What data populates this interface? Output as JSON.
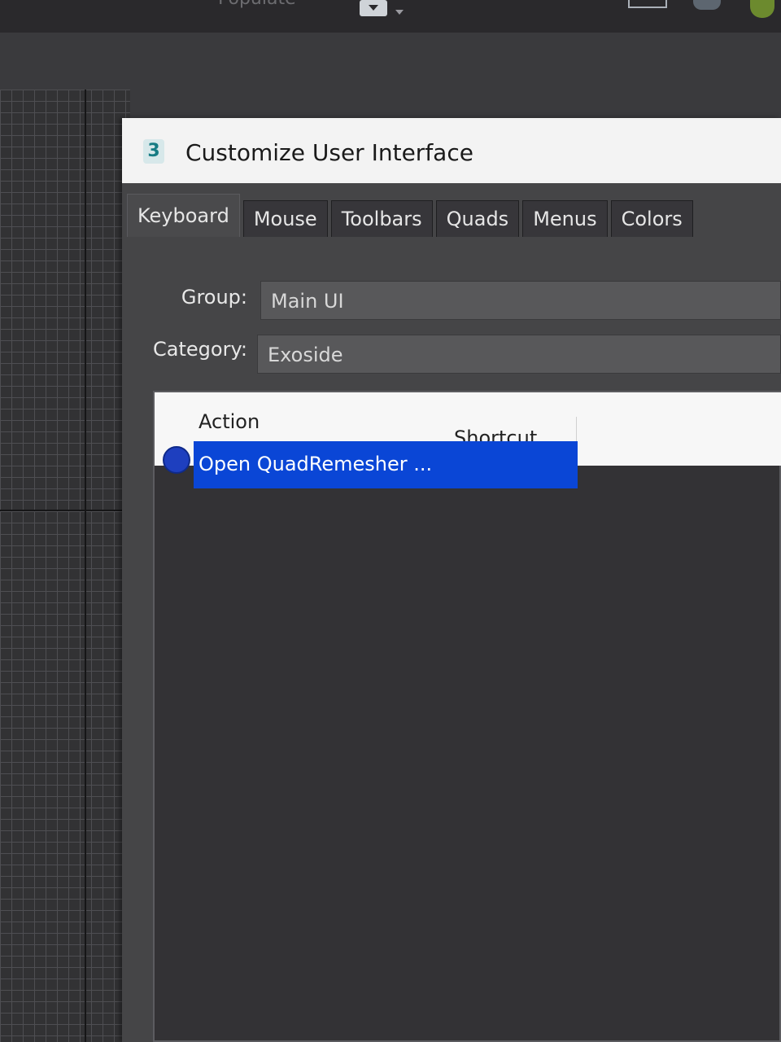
{
  "background": {
    "toolbar_fragment_text": "Populate"
  },
  "dialog": {
    "app_icon_glyph": "3",
    "title": "Customize User Interface",
    "tabs": [
      {
        "label": "Keyboard",
        "active": true
      },
      {
        "label": "Mouse",
        "active": false
      },
      {
        "label": "Toolbars",
        "active": false
      },
      {
        "label": "Quads",
        "active": false
      },
      {
        "label": "Menus",
        "active": false
      },
      {
        "label": "Colors",
        "active": false
      }
    ],
    "group": {
      "label": "Group:",
      "value": "Main UI"
    },
    "category": {
      "label": "Category:",
      "value": "Exoside"
    },
    "list": {
      "columns": {
        "action": "Action",
        "shortcut": "Shortcut"
      },
      "rows": [
        {
          "action": "Open QuadRemesher ...",
          "shortcut": "",
          "selected": true,
          "icon": "quadremesher-icon"
        }
      ]
    }
  },
  "colors": {
    "selection": "#0a46d6",
    "panel": "#454547",
    "titlebar": "#f3f3f3"
  }
}
